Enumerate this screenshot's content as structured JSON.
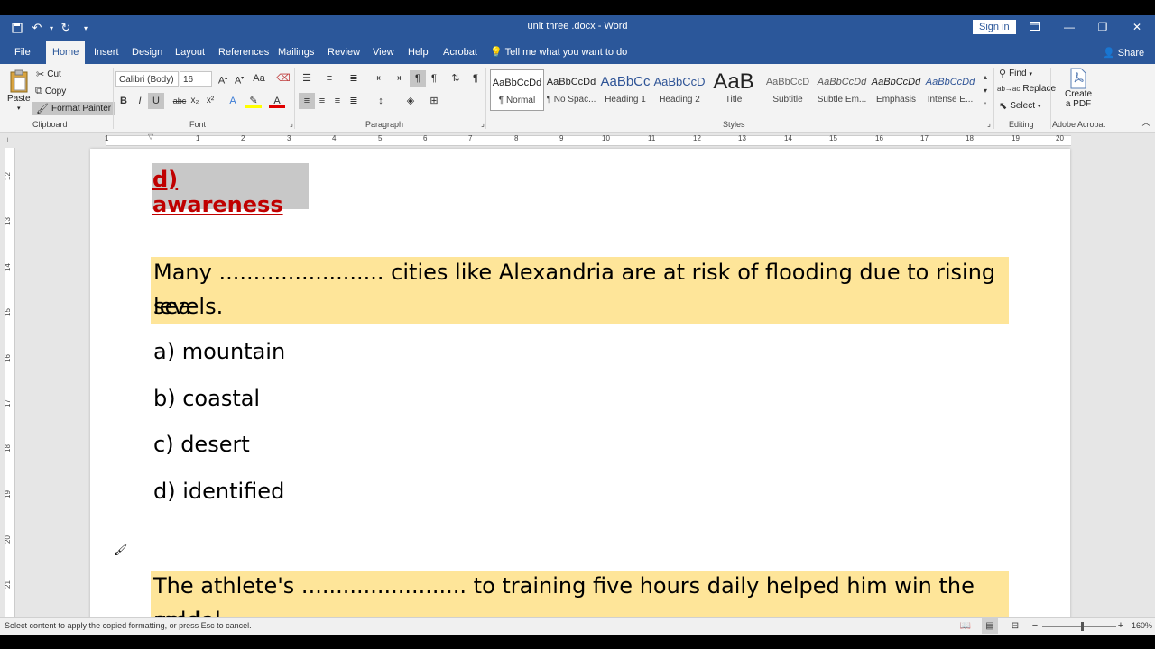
{
  "window": {
    "title": "unit three .docx  -  Word",
    "sign_in": "Sign in",
    "share": "Share",
    "tell_me": "Tell me what you want to do"
  },
  "tabs": [
    "File",
    "Home",
    "Insert",
    "Design",
    "Layout",
    "References",
    "Mailings",
    "Review",
    "View",
    "Help",
    "Acrobat"
  ],
  "active_tab": "Home",
  "clipboard": {
    "group": "Clipboard",
    "paste": "Paste",
    "cut": "Cut",
    "copy": "Copy",
    "format_painter": "Format Painter"
  },
  "font": {
    "group": "Font",
    "family": "Calibri (Body)",
    "size": "16"
  },
  "paragraph": {
    "group": "Paragraph"
  },
  "styles": {
    "group": "Styles",
    "items": [
      {
        "preview": "AaBbCcDd",
        "name": "¶ Normal"
      },
      {
        "preview": "AaBbCcDd",
        "name": "¶ No Spac..."
      },
      {
        "preview": "AaBbCc",
        "name": "Heading 1"
      },
      {
        "preview": "AaBbCcD",
        "name": "Heading 2"
      },
      {
        "preview": "AaB",
        "name": "Title"
      },
      {
        "preview": "AaBbCcD",
        "name": "Subtitle"
      },
      {
        "preview": "AaBbCcDd",
        "name": "Subtle Em..."
      },
      {
        "preview": "AaBbCcDd",
        "name": "Emphasis"
      },
      {
        "preview": "AaBbCcDd",
        "name": "Intense E..."
      }
    ]
  },
  "editing": {
    "group": "Editing",
    "find": "Find",
    "replace": "Replace",
    "select": "Select"
  },
  "acrobat": {
    "group": "Adobe Acrobat",
    "create_pdf_line1": "Create",
    "create_pdf_line2": "a PDF"
  },
  "ruler": {
    "h": [
      "1",
      "1",
      "2",
      "3",
      "4",
      "5",
      "6",
      "7",
      "8",
      "9",
      "10",
      "11",
      "12",
      "13",
      "14",
      "15",
      "16",
      "17",
      "18",
      "19",
      "20"
    ],
    "v": [
      "12",
      "13",
      "14",
      "15",
      "16",
      "17",
      "18",
      "19",
      "20",
      "21"
    ]
  },
  "document": {
    "answer": "d) awareness",
    "q1_line1": "Many ........................ cities like Alexandria are at risk of flooding due to rising sea",
    "q1_line2": "levels.",
    "options": [
      "a) mountain",
      "b) coastal",
      "c) desert",
      "d) identified"
    ],
    "q2_line1": "The athlete's ........................ to training five hours daily helped him win the gold",
    "q2_line2": "medal."
  },
  "status": {
    "message": "Select content to apply the copied formatting, or press Esc to cancel.",
    "zoom": "160%"
  },
  "colors": {
    "accent": "#2b579a",
    "highlight": "#fee599",
    "answer_red": "#c00000"
  }
}
